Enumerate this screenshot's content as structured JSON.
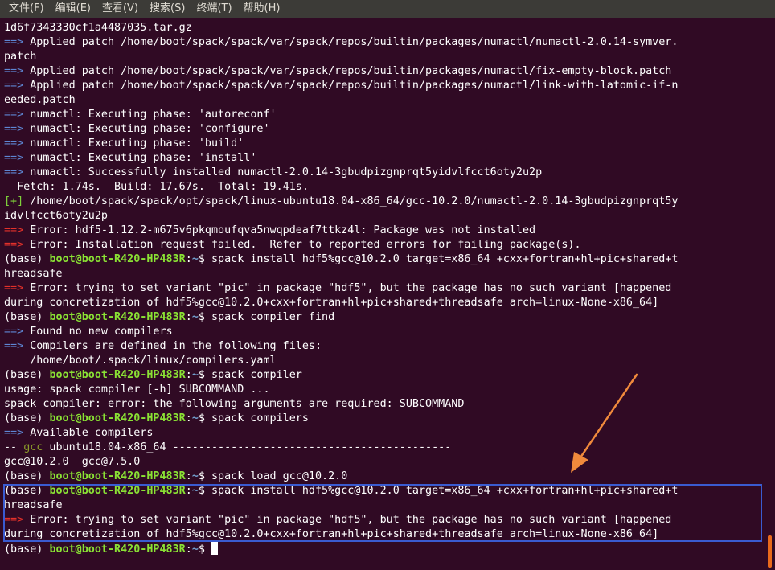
{
  "menu": [
    "文件(F)",
    "编辑(E)",
    "查看(V)",
    "搜索(S)",
    "终端(T)",
    "帮助(H)"
  ],
  "prompt": {
    "env": "(base) ",
    "user_host": "boot@boot-R420-HP483R",
    "sep": ":",
    "path": "~",
    "dollar": "$ "
  },
  "lines": [
    [
      {
        "t": "1d6f7343330cf1a4487035.tar.gz"
      }
    ],
    [
      {
        "t": "==> ",
        "c": "blue"
      },
      {
        "t": "Applied patch /home/boot/spack/spack/var/spack/repos/builtin/packages/numactl/numactl-2.0.14-symver."
      }
    ],
    [
      {
        "t": "patch"
      }
    ],
    [
      {
        "t": "==> ",
        "c": "blue"
      },
      {
        "t": "Applied patch /home/boot/spack/spack/var/spack/repos/builtin/packages/numactl/fix-empty-block.patch"
      }
    ],
    [
      {
        "t": "==> ",
        "c": "blue"
      },
      {
        "t": "Applied patch /home/boot/spack/spack/var/spack/repos/builtin/packages/numactl/link-with-latomic-if-n"
      }
    ],
    [
      {
        "t": "eeded.patch"
      }
    ],
    [
      {
        "t": "==> ",
        "c": "blue"
      },
      {
        "t": "numactl: Executing phase: 'autoreconf'"
      }
    ],
    [
      {
        "t": "==> ",
        "c": "blue"
      },
      {
        "t": "numactl: Executing phase: 'configure'"
      }
    ],
    [
      {
        "t": "==> ",
        "c": "blue"
      },
      {
        "t": "numactl: Executing phase: 'build'"
      }
    ],
    [
      {
        "t": "==> ",
        "c": "blue"
      },
      {
        "t": "numactl: Executing phase: 'install'"
      }
    ],
    [
      {
        "t": "==> ",
        "c": "blue"
      },
      {
        "t": "numactl: Successfully installed numactl-2.0.14-3gbudpizgnprqt5yidvlfcct6oty2u2p"
      }
    ],
    [
      {
        "t": "  Fetch: 1.74s.  Build: 17.67s.  Total: 19.41s."
      }
    ],
    [
      {
        "t": "[+] ",
        "c": "green"
      },
      {
        "t": "/home/boot/spack/spack/opt/spack/linux-ubuntu18.04-x86_64/gcc-10.2.0/numactl-2.0.14-3gbudpizgnprqt5y"
      }
    ],
    [
      {
        "t": "idvlfcct6oty2u2p"
      }
    ],
    [
      {
        "t": "==> ",
        "c": "red"
      },
      {
        "t": "Error: hdf5-1.12.2-m675v6pkqmoufqva5nwqpdeaf7ttkz4l: Package was not installed"
      }
    ],
    [
      {
        "t": "==> ",
        "c": "red"
      },
      {
        "t": "Error: Installation request failed.  Refer to reported errors for failing package(s)."
      }
    ],
    [
      {
        "prompt": true
      },
      {
        "t": "spack install hdf5%gcc@10.2.0 target=x86_64 +cxx+fortran+hl+pic+shared+t"
      }
    ],
    [
      {
        "t": "hreadsafe"
      }
    ],
    [
      {
        "t": "==> ",
        "c": "red"
      },
      {
        "t": "Error: trying to set variant \"pic\" in package \"hdf5\", but the package has no such variant [happened"
      }
    ],
    [
      {
        "t": "during concretization of hdf5%gcc@10.2.0+cxx+fortran+hl+pic+shared+threadsafe arch=linux-None-x86_64]"
      }
    ],
    [
      {
        "prompt": true
      },
      {
        "t": "spack compiler find"
      }
    ],
    [
      {
        "t": "==> ",
        "c": "blue"
      },
      {
        "t": "Found no new compilers"
      }
    ],
    [
      {
        "t": "==> ",
        "c": "blue"
      },
      {
        "t": "Compilers are defined in the following files:"
      }
    ],
    [
      {
        "t": "    /home/boot/.spack/linux/compilers.yaml"
      }
    ],
    [
      {
        "prompt": true
      },
      {
        "t": "spack compiler"
      }
    ],
    [
      {
        "t": "usage: spack compiler [-h] SUBCOMMAND ..."
      }
    ],
    [
      {
        "t": "spack compiler: error: the following arguments are required: SUBCOMMAND"
      }
    ],
    [
      {
        "prompt": true
      },
      {
        "t": "spack compilers"
      }
    ],
    [
      {
        "t": "==> ",
        "c": "blue"
      },
      {
        "t": "Available compilers"
      }
    ],
    [
      {
        "t": "-- "
      },
      {
        "t": "gcc",
        "c": "olive"
      },
      {
        "t": " ubuntu18.04-x86_64 -------------------------------------------"
      }
    ],
    [
      {
        "t": "gcc@10.2.0  gcc@7.5.0"
      }
    ],
    [
      {
        "prompt": true
      },
      {
        "t": "spack load gcc@10.2.0"
      }
    ],
    [
      {
        "prompt": true
      },
      {
        "t": "spack install hdf5%gcc@10.2.0 target=x86_64 +cxx+fortran+hl+pic+shared+t"
      }
    ],
    [
      {
        "t": "hreadsafe"
      }
    ],
    [
      {
        "t": "==> ",
        "c": "red"
      },
      {
        "t": "Error: trying to set variant \"pic\" in package \"hdf5\", but the package has no such variant [happened"
      }
    ],
    [
      {
        "t": "during concretization of hdf5%gcc@10.2.0+cxx+fortran+hl+pic+shared+threadsafe arch=linux-None-x86_64]"
      }
    ],
    [
      {
        "prompt": true
      },
      {
        "cursor": true
      }
    ]
  ],
  "colors": {
    "background": "#300a24",
    "arrow": "#f08a3c",
    "highlight_box": "#3a5bd0",
    "scroll_thumb": "#e96a1c"
  }
}
